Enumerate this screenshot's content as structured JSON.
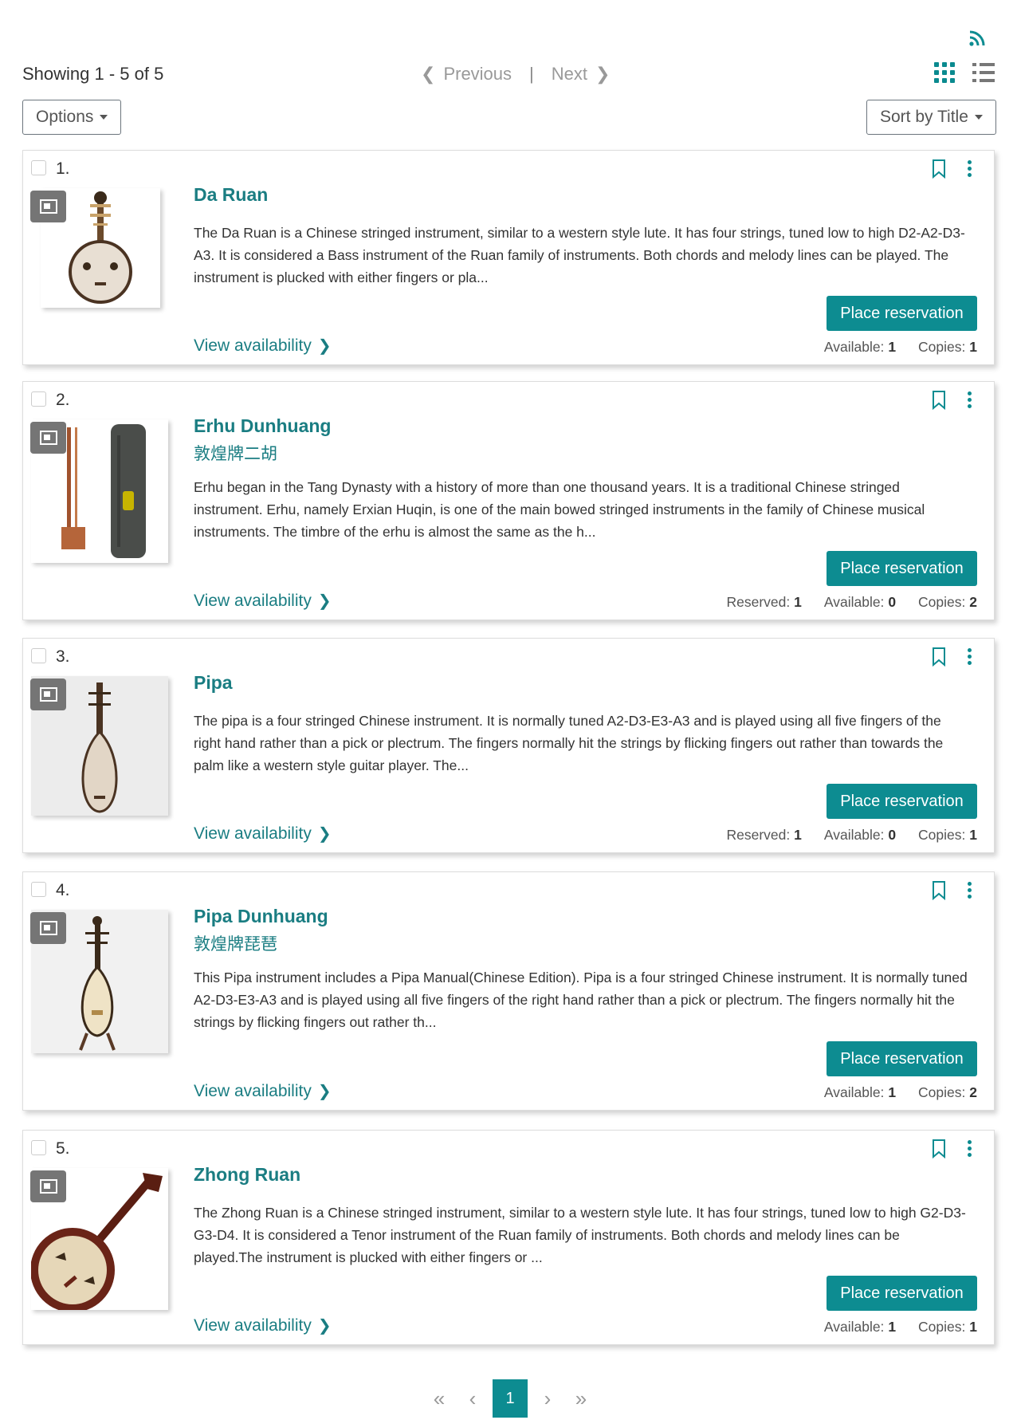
{
  "header": {
    "showing_text": "Showing 1 - 5 of 5",
    "previous_label": "Previous",
    "separator": "|",
    "next_label": "Next"
  },
  "toolbar": {
    "options_label": "Options",
    "sort_label": "Sort by Title"
  },
  "icons": {
    "rss": "rss-icon",
    "grid_view": "grid-view-icon",
    "list_view": "list-view-icon",
    "bookmark": "bookmark-icon",
    "more": "more-options-icon",
    "media": "image-format-icon"
  },
  "colors": {
    "accent": "#0d8c91",
    "title": "#1a7d82"
  },
  "results": [
    {
      "num": "1.",
      "title": "Da Ruan",
      "subtitle": "",
      "description": "The Da Ruan is a Chinese stringed instrument, similar to a western style lute. It has four strings, tuned low to high D2-A2-D3-A3. It is considered a Bass instrument of the Ruan family of instruments. Both chords and melody lines can be played. The instrument is plucked with either fingers or pla...",
      "reserve_label": "Place reservation",
      "availability_label": "View availability",
      "reserved_label": "",
      "reserved_value": "",
      "available_label": "Available:",
      "available_value": "1",
      "copies_label": "Copies:",
      "copies_value": "1"
    },
    {
      "num": "2.",
      "title": "Erhu Dunhuang",
      "subtitle": "敦煌牌二胡",
      "description": "Erhu began in the Tang Dynasty with a history of more than one thousand years. It is a traditional Chinese stringed instrument. Erhu, namely Erxian Huqin, is one of the main bowed stringed instruments in the family of Chinese musical instruments. The timbre of the erhu is almost the same as the h...",
      "reserve_label": "Place reservation",
      "availability_label": "View availability",
      "reserved_label": "Reserved:",
      "reserved_value": "1",
      "available_label": "Available:",
      "available_value": "0",
      "copies_label": "Copies:",
      "copies_value": "2"
    },
    {
      "num": "3.",
      "title": "Pipa",
      "subtitle": "",
      "description": "The pipa is a four stringed Chinese instrument. It is normally tuned A2-D3-E3-A3 and is played using all five fingers of the right hand rather than a pick or plectrum. The fingers normally hit the strings by flicking fingers out rather than towards the palm like a western style guitar player. The...",
      "reserve_label": "Place reservation",
      "availability_label": "View availability",
      "reserved_label": "Reserved:",
      "reserved_value": "1",
      "available_label": "Available:",
      "available_value": "0",
      "copies_label": "Copies:",
      "copies_value": "1"
    },
    {
      "num": "4.",
      "title": "Pipa Dunhuang",
      "subtitle": "敦煌牌琵琶",
      "description": "This Pipa instrument includes a Pipa Manual(Chinese Edition). Pipa is a four stringed Chinese instrument. It is normally tuned A2-D3-E3-A3 and is played using all five fingers of the right hand rather than a pick or plectrum. The fingers normally hit the strings by flicking fingers out rather th...",
      "reserve_label": "Place reservation",
      "availability_label": "View availability",
      "reserved_label": "",
      "reserved_value": "",
      "available_label": "Available:",
      "available_value": "1",
      "copies_label": "Copies:",
      "copies_value": "2"
    },
    {
      "num": "5.",
      "title": "Zhong Ruan",
      "subtitle": "",
      "description": "The Zhong Ruan is a Chinese stringed instrument, similar to a western style lute. It has four strings, tuned low to high G2-D3-G3-D4. It is considered a Tenor instrument of the Ruan family of instruments. Both chords and melody lines can be played.The instrument is plucked with either fingers or ...",
      "reserve_label": "Place reservation",
      "availability_label": "View availability",
      "reserved_label": "",
      "reserved_value": "",
      "available_label": "Available:",
      "available_value": "1",
      "copies_label": "Copies:",
      "copies_value": "1"
    }
  ],
  "pagination": {
    "first": "«",
    "prev": "‹",
    "current": "1",
    "next": "›",
    "last": "»"
  }
}
